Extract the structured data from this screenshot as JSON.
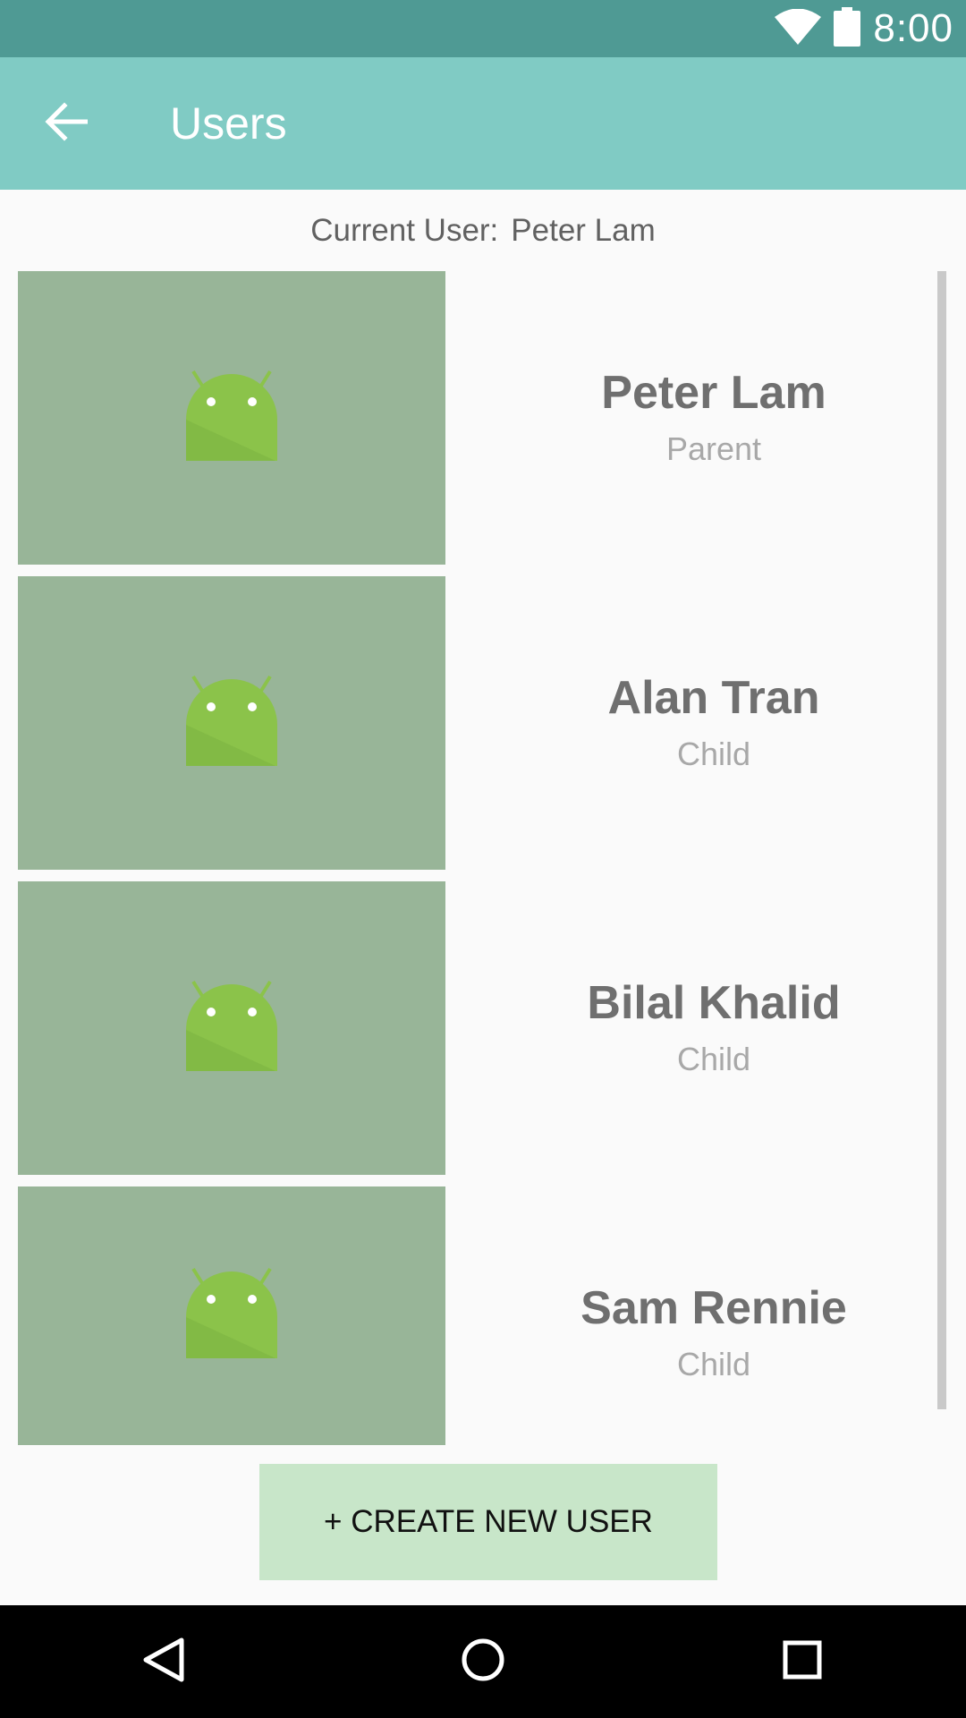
{
  "status_bar": {
    "time": "8:00",
    "bg_color": "#4f9a94",
    "icons": [
      "wifi-icon",
      "battery-icon"
    ]
  },
  "app_bar": {
    "title": "Users",
    "bg_color": "#80cbc4",
    "back_icon": "arrow-back-icon"
  },
  "current_user": {
    "label": "Current User:",
    "value": "Peter Lam"
  },
  "users": [
    {
      "name": "Peter Lam",
      "role": "Parent",
      "avatar_icon": "android-icon"
    },
    {
      "name": "Alan Tran",
      "role": "Child",
      "avatar_icon": "android-icon"
    },
    {
      "name": "Bilal Khalid",
      "role": "Child",
      "avatar_icon": "android-icon"
    },
    {
      "name": "Sam Rennie",
      "role": "Child",
      "avatar_icon": "android-icon"
    }
  ],
  "create_button": {
    "label": "+ CREATE NEW USER",
    "bg_color": "#c8e6c9"
  },
  "nav_bar": {
    "buttons": [
      "back-triangle-icon",
      "home-circle-icon",
      "recents-square-icon"
    ]
  }
}
